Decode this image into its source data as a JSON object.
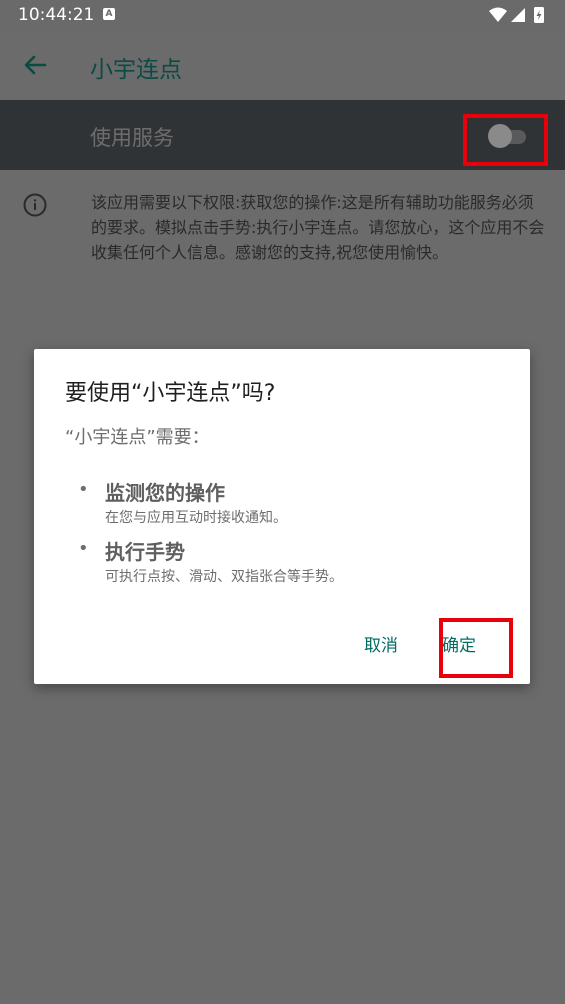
{
  "status_bar": {
    "time": "10:44:21",
    "notification_icon": "a-icon",
    "icons": [
      "wifi-icon",
      "signal-icon",
      "battery-charging-icon"
    ]
  },
  "app_bar": {
    "back_icon": "arrow-back-icon",
    "title": "小宇连点"
  },
  "service": {
    "label": "使用服务",
    "toggle_on": false
  },
  "info": {
    "icon": "info-icon",
    "text": "该应用需要以下权限:获取您的操作:这是所有辅助功能服务必须的要求。模拟点击手势:执行小宇连点。请您放心，这个应用不会收集任何个人信息。感谢您的支持,祝您使用愉快。"
  },
  "dialog": {
    "title": "要使用“小宇连点”吗?",
    "subtitle": "“小宇连点”需要：",
    "permissions": [
      {
        "bullet": "•",
        "title": "监测您的操作",
        "description": "在您与应用互动时接收通知。"
      },
      {
        "bullet": "•",
        "title": "执行手势",
        "description": "可执行点按、滑动、双指张合等手势。"
      }
    ],
    "cancel_label": "取消",
    "confirm_label": "确定"
  },
  "colors": {
    "scrim": "#6b6b6b",
    "service_row": "#303336",
    "accent": "#006c62",
    "highlight": "#e8000a"
  }
}
